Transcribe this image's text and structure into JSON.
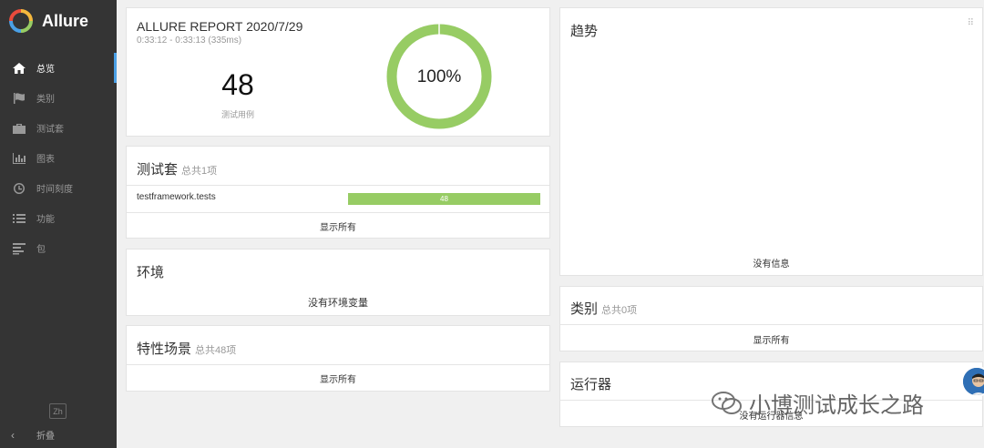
{
  "app": {
    "name": "Allure",
    "brand_colors": [
      "#e84b3c",
      "#f5b83d",
      "#97cc64",
      "#4aa0e6"
    ]
  },
  "sidebar": {
    "items": [
      {
        "label": "总览",
        "icon": "home-icon",
        "active": true
      },
      {
        "label": "类别",
        "icon": "flag-icon",
        "active": false
      },
      {
        "label": "测试套",
        "icon": "briefcase-icon",
        "active": false
      },
      {
        "label": "图表",
        "icon": "bar-chart-icon",
        "active": false
      },
      {
        "label": "时间刻度",
        "icon": "clock-icon",
        "active": false
      },
      {
        "label": "功能",
        "icon": "list-icon",
        "active": false
      },
      {
        "label": "包",
        "icon": "align-left-icon",
        "active": false
      }
    ],
    "lang": "Zh",
    "collapse_label": "折叠"
  },
  "summary": {
    "title": "ALLURE REPORT 2020/7/29",
    "time": "0:33:12 - 0:33:13 (335ms)",
    "count": "48",
    "count_label": "测试用例",
    "percent": "100%",
    "pass_fraction": 1.0,
    "pass_color": "#97cc64"
  },
  "suites": {
    "title": "测试套",
    "subtitle": "总共1项",
    "rows": [
      {
        "name": "testframework.tests",
        "value": "48"
      }
    ],
    "show_all": "显示所有"
  },
  "environment": {
    "title": "环境",
    "empty": "没有环境变量"
  },
  "features": {
    "title": "特性场景",
    "subtitle": "总共48项",
    "show_all": "显示所有"
  },
  "trend": {
    "title": "趋势",
    "empty": "没有信息"
  },
  "categories": {
    "title": "类别",
    "subtitle": "总共0项",
    "show_all": "显示所有"
  },
  "executors": {
    "title": "运行器",
    "empty": "没有运行器信息"
  },
  "watermark": {
    "text": "小博测试成长之路"
  }
}
